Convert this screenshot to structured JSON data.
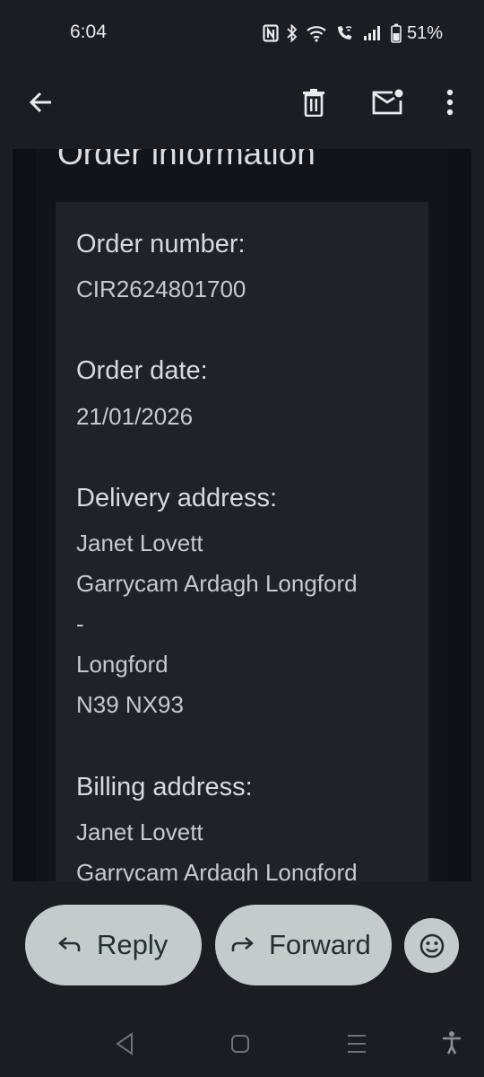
{
  "status_bar": {
    "time": "6:04",
    "battery": "51%",
    "icons": [
      "nfc-icon",
      "bluetooth-icon",
      "wifi-icon",
      "wifi-calling-icon",
      "signal-icon",
      "battery-icon"
    ]
  },
  "app_bar": {
    "icons": [
      "back-arrow-icon",
      "delete-icon",
      "mark-unread-icon",
      "more-vert-icon"
    ]
  },
  "email": {
    "section_title": "Order information",
    "order_number_label": "Order number:",
    "order_number": "CIR2624801700",
    "order_date_label": "Order date:",
    "order_date": "21/01/2026",
    "delivery_label": "Delivery address:",
    "delivery_lines": [
      "Janet Lovett",
      "Garrycam Ardagh Longford",
      "-",
      "Longford",
      "N39 NX93"
    ],
    "billing_label": "Billing address:",
    "billing_lines": [
      "Janet Lovett",
      "Garrycam Ardagh Longford"
    ]
  },
  "actions": {
    "reply": "Reply",
    "forward": "Forward",
    "emoji_icon": "emoji-icon"
  },
  "nav_bar": {
    "icons": [
      "back-icon",
      "home-icon",
      "recents-icon",
      "accessibility-icon"
    ]
  },
  "colors": {
    "background": "#1b1d21",
    "card": "#1f2226",
    "pill_button": "#c4cbcb"
  }
}
